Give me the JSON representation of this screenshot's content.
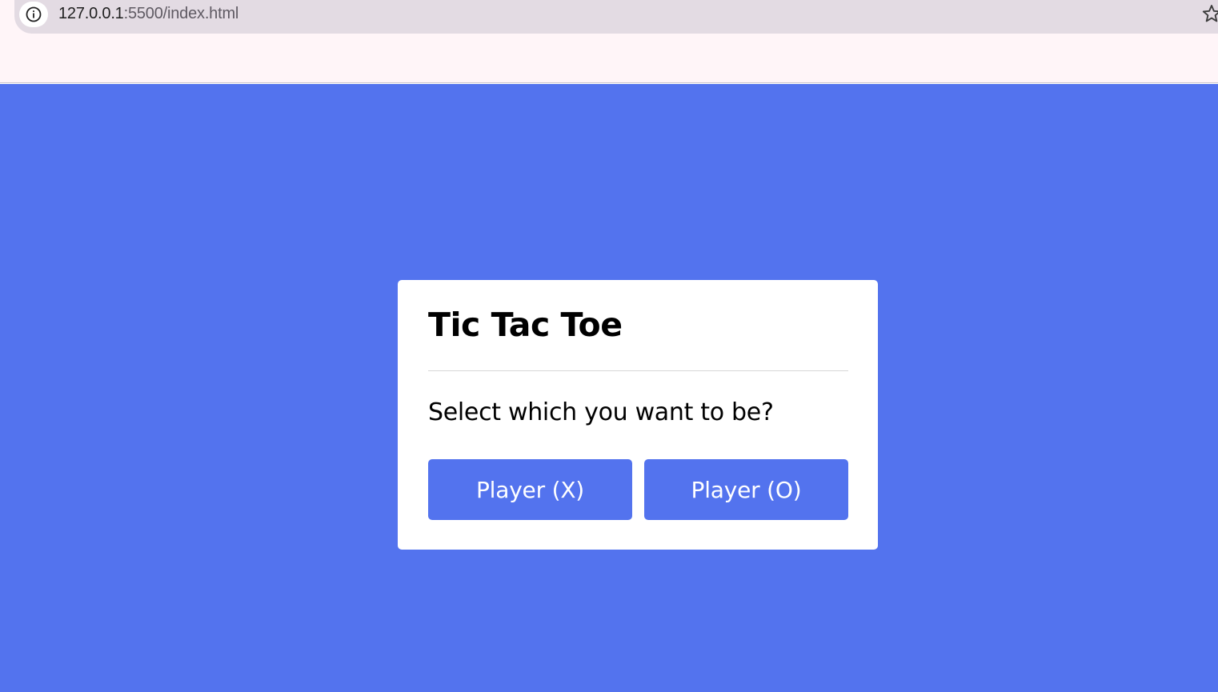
{
  "browser": {
    "url_host": "127.0.0.1",
    "url_path": ":5500/index.html",
    "info_icon": "info-icon",
    "bookmark_icon": "star-icon"
  },
  "colors": {
    "page_background": "#5373ee",
    "card_background": "#ffffff",
    "button_background": "#5373ee",
    "button_text": "#ffffff"
  },
  "select_box": {
    "title": "Tic Tac Toe",
    "prompt": "Select which you want to be?",
    "player_x_label": "Player (X)",
    "player_o_label": "Player (O)"
  }
}
